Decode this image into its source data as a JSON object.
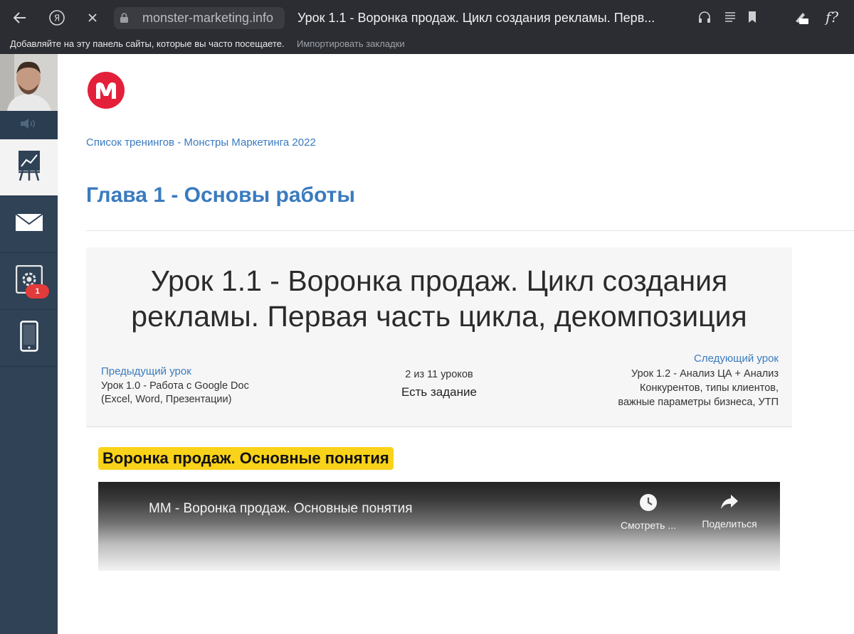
{
  "browser": {
    "domain": "monster-marketing.info",
    "tab_title": "Урок 1.1 - Воронка продаж. Цикл создания рекламы. Перв...",
    "bookmarks_hint": "Добавляйте на эту панель сайты, которые вы часто посещаете.",
    "import_bookmarks": "Импортировать закладки"
  },
  "sidebar": {
    "badge_count": "1",
    "items": [
      "training-icon",
      "mail-icon",
      "settings-icon",
      "phone-icon"
    ]
  },
  "breadcrumb": "Список тренингов -  Монстры Маркетинга 2022",
  "chapter_title": "Глава 1 - Основы работы",
  "lesson": {
    "title": "Урок 1.1 - Воронка продаж. Цикл создания рекламы. Первая часть цикла, декомпозиция",
    "prev_label": "Предыдущий урок",
    "prev_text": "Урок 1.0 - Работа с Google Doc (Excel, Word, Презентации)",
    "progress": "2 из 11 уроков",
    "task": "Есть задание",
    "next_label": "Следующий урок",
    "next_text": "Урок 1.2 - Анализ ЦА + Анализ Конкурентов, типы клиентов, важные параметры бизнеса, УТП"
  },
  "section_heading": "Воронка продаж. Основные понятия",
  "video": {
    "title": "ММ - Воронка продаж. Основные понятия",
    "watch_later": "Смотреть ...",
    "share": "Поделиться"
  },
  "colors": {
    "link": "#3a7bbf",
    "highlight": "#f9d21a",
    "sidebar": "#2f4256",
    "badge": "#e23b3b"
  }
}
